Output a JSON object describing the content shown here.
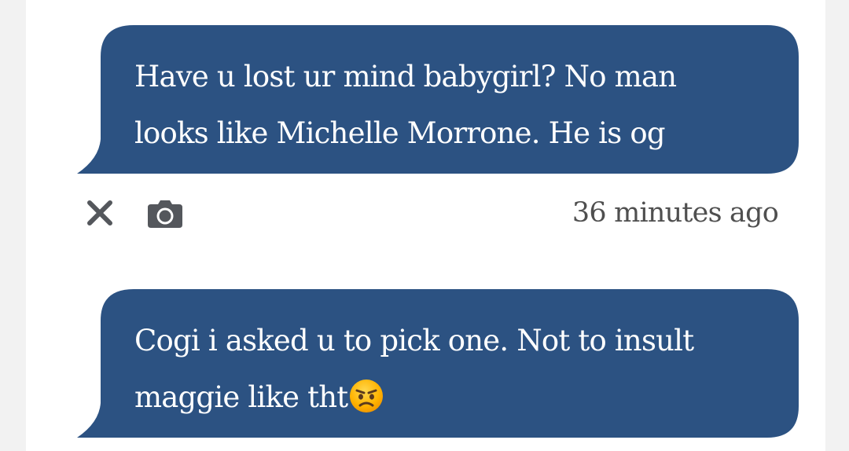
{
  "colors": {
    "bubble_background": "#2c5282",
    "bubble_text": "#ffffff",
    "meta_icon": "#54575c",
    "timestamp_text": "#4f4f4f"
  },
  "messages": [
    {
      "text": "Have u lost ur mind babygirl? No man\nlooks like Michelle Morrone. He is og",
      "emoji": null
    },
    {
      "text": "Cogi i asked u to pick one. Not to insult\nmaggie like tht",
      "emoji": "angry-face-emoji"
    }
  ],
  "message_meta": {
    "close_icon": "close-icon",
    "camera_icon": "camera-icon",
    "timestamp": "36 minutes ago"
  }
}
